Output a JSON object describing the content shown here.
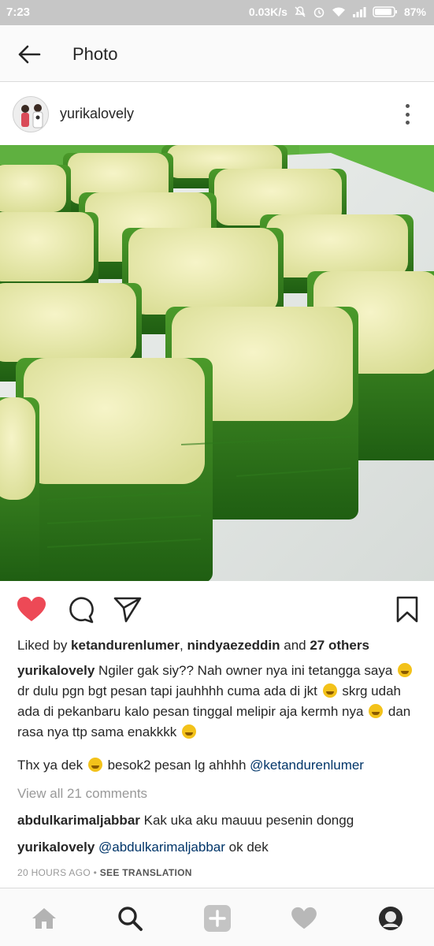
{
  "status_bar": {
    "time": "7:23",
    "network_speed": "0.03K/s",
    "battery_percent": "87%",
    "icons": [
      "mute-icon",
      "alarm-icon",
      "wifi-icon",
      "signal-icon",
      "battery-icon"
    ]
  },
  "header": {
    "title": "Photo",
    "back_icon": "arrow-left-icon"
  },
  "post": {
    "username": "yurikalovely",
    "more_icon": "more-vertical-icon",
    "photo_description": "kue-pandan-leaf-custard-cakes"
  },
  "actions": {
    "like_icon": "heart-filled-icon",
    "like_color": "#ed4956",
    "comment_icon": "comment-icon",
    "share_icon": "send-icon",
    "save_icon": "bookmark-icon"
  },
  "likes": {
    "prefix": "Liked by ",
    "user1": "ketandurenlumer",
    "sep": ", ",
    "user2": "nindyaezeddin",
    "and": " and ",
    "others": "27 others"
  },
  "caption": {
    "username": "yurikalovely",
    "part1": " Ngiler gak siy?? Nah owner nya ini tetangga saya ",
    "part2": " dr dulu pgn bgt pesan tapi jauhhhh cuma ada di jkt ",
    "part3": " skrg udah ada di pekanbaru kalo pesan tinggal melipir aja kermh nya ",
    "part4": " dan rasa nya ttp sama enakkkk ",
    "reply_part1": "Thx ya dek ",
    "reply_part2": " besok2 pesan lg ahhhh ",
    "reply_mention": "@ketandurenlumer"
  },
  "view_all_comments": "View all 21 comments",
  "comments": [
    {
      "username": "abdulkarimaljabbar",
      "text": " Kak uka aku mauuu pesenin dongg"
    },
    {
      "username": "yurikalovely",
      "mention": "@abdulkarimaljabbar",
      "text": " ok dek"
    }
  ],
  "timestamp": {
    "time": "20 HOURS AGO",
    "separator": " • ",
    "translation": "SEE TRANSLATION"
  },
  "bottom_nav": {
    "items": [
      "home-icon",
      "search-icon",
      "add-icon",
      "activity-heart-icon",
      "profile-avatar"
    ]
  }
}
